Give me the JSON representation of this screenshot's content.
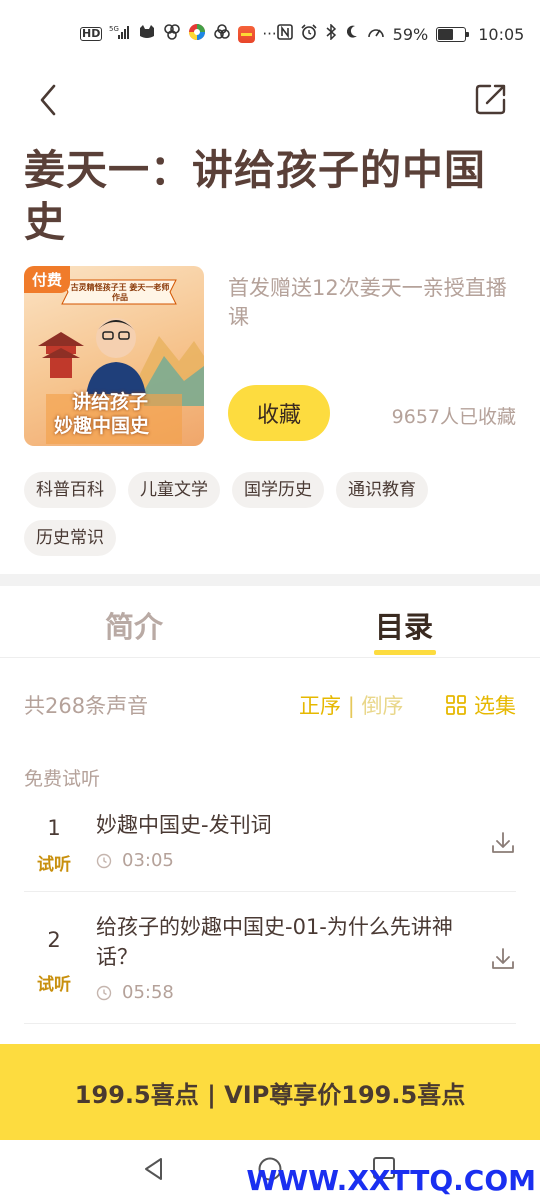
{
  "status_bar": {
    "network": "HD",
    "signal": "5G",
    "battery_percent": "59%",
    "time": "10:05",
    "battery_level": 0.59
  },
  "nav": {
    "back_icon": "chevron-left-icon",
    "share_icon": "share-icon"
  },
  "album": {
    "title": "姜天一：讲给孩子的中国史",
    "cover_badge": "付费",
    "cover_subtitle": "古灵精怪孩子王 姜天一老师作品",
    "cover_title_line1": "讲给孩子",
    "cover_title_line2": "妙趣中国史",
    "promo": "首发赠送12次姜天一亲授直播课",
    "collect_label": "收藏",
    "collect_count": "9657人已收藏"
  },
  "tags": [
    "科普百科",
    "儿童文学",
    "国学历史",
    "通识教育",
    "历史常识"
  ],
  "tabs": {
    "intro": "简介",
    "catalog": "目录",
    "active": "catalog"
  },
  "list": {
    "total": "共268条声音",
    "sort_asc": "正序",
    "sort_sep": "|",
    "sort_desc": "倒序",
    "select_label": "选集",
    "free_section": "免费试听"
  },
  "tracks": [
    {
      "num": "1",
      "trial": "试听",
      "title": "妙趣中国史-发刊词",
      "duration": "03:05"
    },
    {
      "num": "2",
      "trial": "试听",
      "title": "给孩子的妙趣中国史-01-为什么先讲神话？",
      "duration": "05:58"
    }
  ],
  "buy_bar": {
    "text": "199.5喜点 | VIP尊享价199.5喜点"
  },
  "watermark": "WWW.XXTTQ.COM",
  "colors": {
    "accent_yellow": "#fddc3f",
    "title_brown": "#5a4038",
    "muted": "#b5a29a",
    "trial_gold": "#c8900e"
  }
}
